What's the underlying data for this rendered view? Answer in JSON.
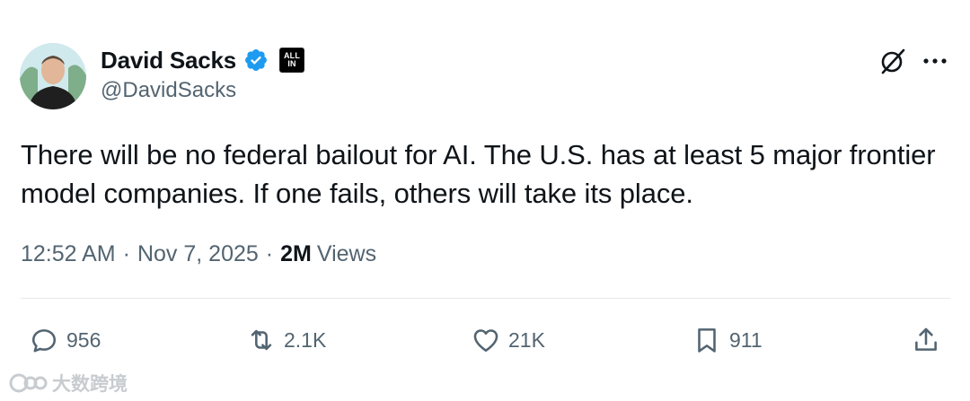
{
  "author": {
    "display_name": "David Sacks",
    "handle": "@DavidSacks",
    "verified_icon": "verified-badge-icon",
    "affiliate_badge": {
      "line1": "ALL",
      "line2": "IN"
    }
  },
  "tweet": {
    "text": "There will be no federal bailout for AI. The U.S. has at least 5 major frontier model companies. If one fails, others will take its place.",
    "time": "12:52 AM",
    "date": "Nov 7, 2025",
    "separator": "·",
    "views_count": "2M",
    "views_label": "Views"
  },
  "actions": {
    "reply": {
      "icon": "reply-icon",
      "count": "956"
    },
    "retweet": {
      "icon": "retweet-icon",
      "count": "2.1K"
    },
    "like": {
      "icon": "heart-icon",
      "count": "21K"
    },
    "bookmark": {
      "icon": "bookmark-icon",
      "count": "911"
    },
    "share": {
      "icon": "share-icon"
    }
  },
  "header_icons": [
    "grok-icon",
    "more-icon"
  ],
  "watermark": {
    "text": "大数跨境"
  },
  "colors": {
    "text_primary": "#0f1419",
    "text_secondary": "#536471",
    "verified_blue": "#1d9bf0",
    "divider": "#e6e9eb"
  }
}
